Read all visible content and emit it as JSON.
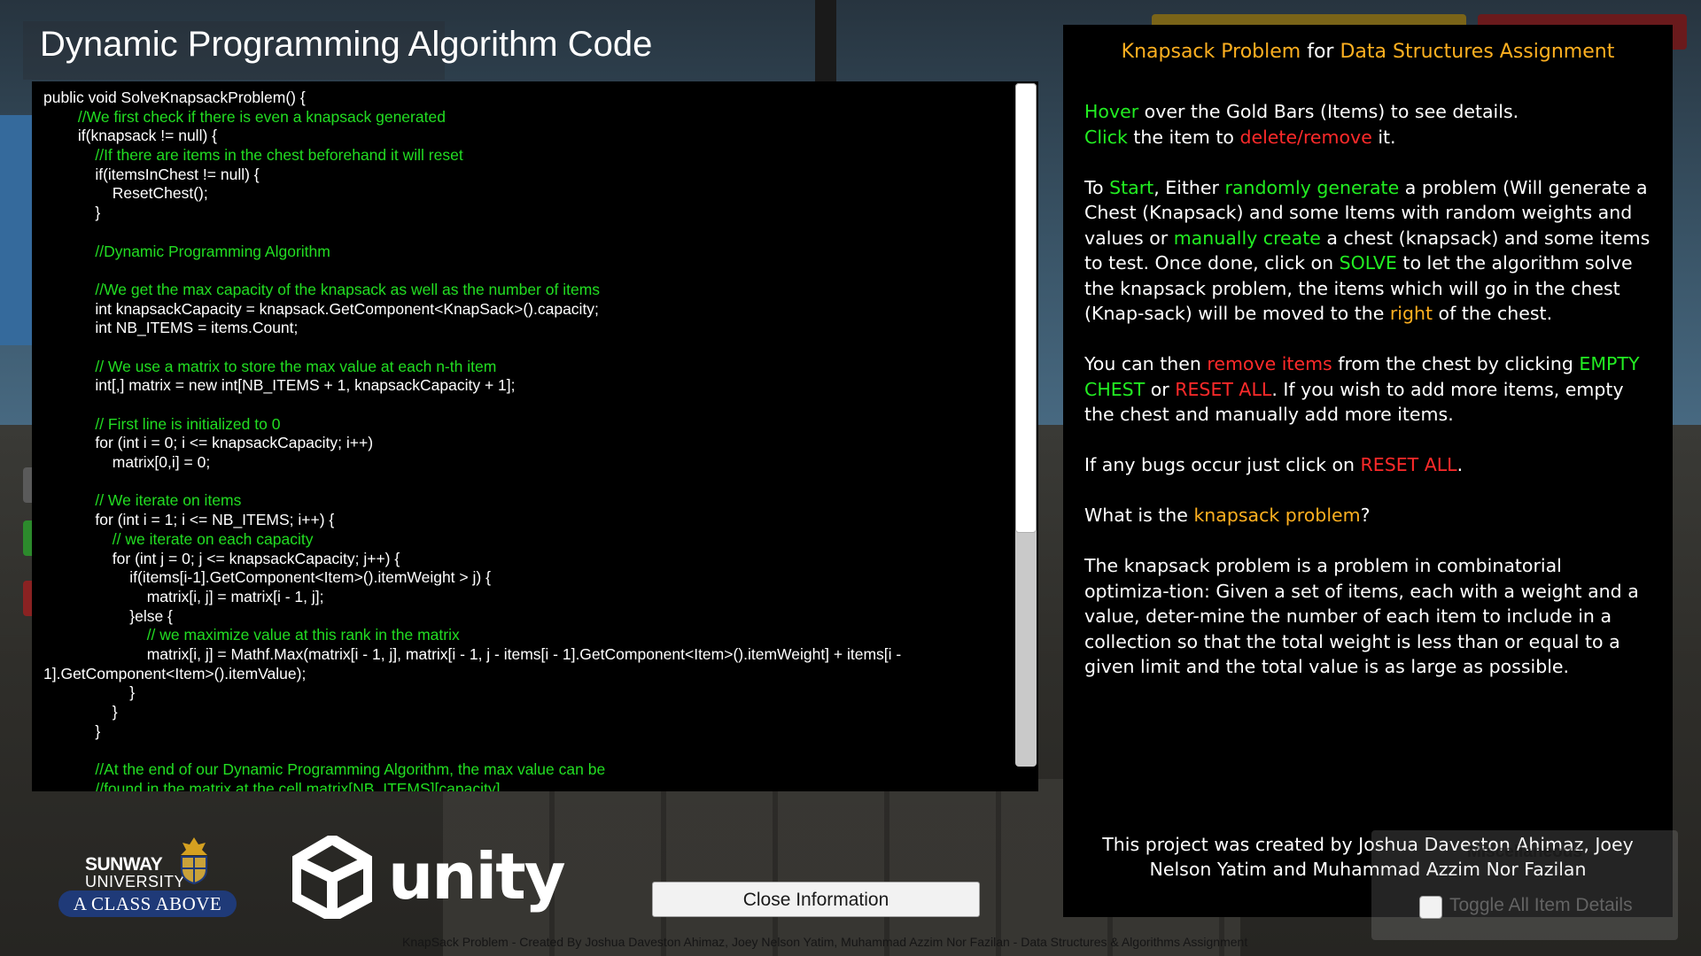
{
  "code_panel": {
    "title": "Dynamic Programming Algorithm Code",
    "lines": [
      {
        "text": "public void SolveKnapsackProblem() {",
        "comment": false
      },
      {
        "text": "        //We first check if there is even a knapsack generated",
        "comment": true
      },
      {
        "text": "        if(knapsack != null) {",
        "comment": false
      },
      {
        "text": "            //If there are items in the chest beforehand it will reset",
        "comment": true
      },
      {
        "text": "            if(itemsInChest != null) {",
        "comment": false
      },
      {
        "text": "                ResetChest();",
        "comment": false
      },
      {
        "text": "            }",
        "comment": false
      },
      {
        "text": "",
        "comment": false
      },
      {
        "text": "            //Dynamic Programming Algorithm",
        "comment": true
      },
      {
        "text": "",
        "comment": false
      },
      {
        "text": "            //We get the max capacity of the knapsack as well as the number of items",
        "comment": true
      },
      {
        "text": "            int knapsackCapacity = knapsack.GetComponent<KnapSack>().capacity;",
        "comment": false
      },
      {
        "text": "            int NB_ITEMS = items.Count;",
        "comment": false
      },
      {
        "text": "",
        "comment": false
      },
      {
        "text": "            // We use a matrix to store the max value at each n-th item",
        "comment": true
      },
      {
        "text": "            int[,] matrix = new int[NB_ITEMS + 1, knapsackCapacity + 1];",
        "comment": false
      },
      {
        "text": "",
        "comment": false
      },
      {
        "text": "            // First line is initialized to 0",
        "comment": true
      },
      {
        "text": "            for (int i = 0; i <= knapsackCapacity; i++)",
        "comment": false
      },
      {
        "text": "                matrix[0,i] = 0;",
        "comment": false
      },
      {
        "text": "",
        "comment": false
      },
      {
        "text": "            // We iterate on items",
        "comment": true
      },
      {
        "text": "            for (int i = 1; i <= NB_ITEMS; i++) {",
        "comment": false
      },
      {
        "text": "                // we iterate on each capacity",
        "comment": true
      },
      {
        "text": "                for (int j = 0; j <= knapsackCapacity; j++) {",
        "comment": false
      },
      {
        "text": "                    if(items[i-1].GetComponent<Item>().itemWeight > j) {",
        "comment": false
      },
      {
        "text": "                        matrix[i, j] = matrix[i - 1, j];",
        "comment": false
      },
      {
        "text": "                    }else {",
        "comment": false
      },
      {
        "text": "                        // we maximize value at this rank in the matrix",
        "comment": true
      },
      {
        "text": "                        matrix[i, j] = Mathf.Max(matrix[i - 1, j], matrix[i - 1, j - items[i - 1].GetComponent<Item>().itemWeight] + items[i - 1].GetComponent<Item>().itemValue);",
        "comment": false,
        "wrap": true
      },
      {
        "text": "                    }",
        "comment": false
      },
      {
        "text": "                }",
        "comment": false
      },
      {
        "text": "            }",
        "comment": false
      },
      {
        "text": "",
        "comment": false
      },
      {
        "text": "            //At the end of our Dynamic Programming Algorithm, the max value can be",
        "comment": true
      },
      {
        "text": "            //found in the matrix at the cell matrix[NB_ITEMS][capacity]",
        "comment": true
      }
    ]
  },
  "logos": {
    "sunway_name": "SUNWAY",
    "sunway_university": "UNIVERSITY",
    "sunway_tagline": "A CLASS ABOVE",
    "unity_word": "unity"
  },
  "close_button": "Close Information",
  "footer": "KnapSack Problem - Created By Joshua Daveston Ahimaz, Joey Nelson Yatim, Muhammad Azzim Nor Fazilan - Data Structures & Algorithms Assignment",
  "info_panel": {
    "title": [
      {
        "text": "Knapsack Problem",
        "color": "#ffb020"
      },
      {
        "text": " for ",
        "color": "#ffffff"
      },
      {
        "text": "Data Structures Assignment",
        "color": "#ffb020"
      }
    ],
    "paragraphs": [
      [
        {
          "text": "Hover",
          "style": "g"
        },
        {
          "text": " over the Gold Bars (Items) to see details.",
          "style": ""
        },
        {
          "br": true
        },
        {
          "text": "Click",
          "style": "g"
        },
        {
          "text": " the item to ",
          "style": ""
        },
        {
          "text": "delete/remove",
          "style": "r"
        },
        {
          "text": " it.",
          "style": ""
        }
      ],
      [
        {
          "text": "To ",
          "style": ""
        },
        {
          "text": "Start",
          "style": "g"
        },
        {
          "text": ", Either ",
          "style": ""
        },
        {
          "text": "randomly generate",
          "style": "g"
        },
        {
          "text": " a problem (Will generate a Chest (Knapsack) and some Items with random weights and values or ",
          "style": ""
        },
        {
          "text": "manually create",
          "style": "g"
        },
        {
          "text": " a chest (knapsack) and some items to test. Once done, click on ",
          "style": ""
        },
        {
          "text": "SOLVE",
          "style": "g"
        },
        {
          "text": " to let the algorithm solve the knapsack problem, the items which will go in the chest (Knap-sack) will be moved to the ",
          "style": ""
        },
        {
          "text": "right",
          "style": "o"
        },
        {
          "text": " of the chest.",
          "style": ""
        }
      ],
      [
        {
          "text": "You can then ",
          "style": ""
        },
        {
          "text": "remove items",
          "style": "r"
        },
        {
          "text": " from the chest by clicking ",
          "style": ""
        },
        {
          "text": "EMPTY CHEST",
          "style": "g"
        },
        {
          "text": " or ",
          "style": ""
        },
        {
          "text": "RESET ALL",
          "style": "r"
        },
        {
          "text": ". If you wish to add more items, empty the chest and manually add more items.",
          "style": ""
        }
      ],
      [
        {
          "text": "If any bugs occur just click on ",
          "style": ""
        },
        {
          "text": "RESET ALL",
          "style": "r"
        },
        {
          "text": ".",
          "style": ""
        }
      ],
      [
        {
          "text": "What is the ",
          "style": ""
        },
        {
          "text": "knapsack problem",
          "style": "o"
        },
        {
          "text": "?",
          "style": ""
        }
      ],
      [
        {
          "text": "The knapsack problem is a problem in combinatorial optimiza-tion: Given a set of items, each with a weight and a value, deter-mine the number of each item to include in a collection so that the total weight is less than or equal to a given limit and the total value is as large as possible.",
          "style": ""
        }
      ]
    ],
    "credits": "This project was created by Joshua Daveston Ahimaz, Joey Nelson Yatim and Muhammad Azzim Nor Fazilan"
  },
  "misc": {
    "title": "Miscellaneous",
    "toggle_label": "Toggle All Item Details",
    "toggle_checked": false
  },
  "colors": {
    "comment_green": "#22dd22",
    "highlight_green": "#22ee22",
    "highlight_red": "#ff2a2a",
    "highlight_orange": "#ffb020"
  }
}
